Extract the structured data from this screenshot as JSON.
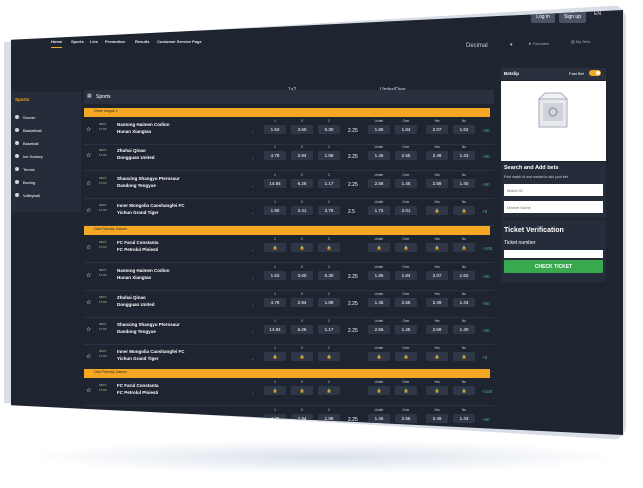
{
  "header": {
    "login_label": "Log in",
    "signup_label": "Sign up",
    "language": "EN"
  },
  "nav": {
    "items": [
      "Home",
      "Sports",
      "Live",
      "Promotion",
      "Results",
      "Customer Service Page"
    ],
    "odds_format": "Decimal",
    "favorites_label": "Favorites",
    "mybets_label": "My Bets"
  },
  "sidebar": {
    "title": "Sports",
    "items": [
      "Soccer",
      "Basketball",
      "Baseball",
      "Ice Hockey",
      "Tennis",
      "Boxing",
      "Volleyball"
    ]
  },
  "main": {
    "header_label": "Sports",
    "col_1x2": "1x2",
    "col_underover": "Under/Over",
    "leagues": [
      "Chine league 1",
      "Club Friendly Games",
      "Club Friendly Games"
    ],
    "labels_1x2": [
      "1",
      "X",
      "2"
    ],
    "labels_uo": [
      "Under",
      "Over"
    ],
    "labels_yn": [
      "Yes",
      "No"
    ],
    "matches": [
      {
        "date": "06/07",
        "time": "17:00",
        "t1": "Nantong Haimen Codion",
        "t2": "Hunan Xiangtao",
        "o1": "1.63",
        "ox": "3.60",
        "o2": "5.30",
        "hcp": "2.25",
        "un": "1.86",
        "ov": "1.84",
        "yes": "2.07",
        "no": "1.62",
        "more": "+50"
      },
      {
        "date": "06/07",
        "time": "17:00",
        "t1": "Zhuhai Qinao",
        "t2": "Dongguan United",
        "o1": "4.78",
        "ox": "2.94",
        "o2": "1.88",
        "hcp": "2.25",
        "un": "1.45",
        "ov": "2.55",
        "yes": "2.49",
        "no": "1.43",
        "more": "+50"
      },
      {
        "date": "06/07",
        "time": "17:00",
        "t1": "Shaoxing Shangyu Pterosaur",
        "t2": "Dandong Tengyue",
        "o1": "14.84",
        "ox": "6.26",
        "o2": "1.17",
        "hcp": "2.25",
        "un": "2.56",
        "ov": "1.45",
        "yes": "2.59",
        "no": "1.40",
        "more": "+50"
      },
      {
        "date": "06/07",
        "time": "17:00",
        "t1": "Inner Mongolia Caoshangfei FC",
        "t2": "Yichun Grand Tiger",
        "o1": "1.90",
        "ox": "3.41",
        "o2": "3.75",
        "hcp": "2.5",
        "un": "1.72",
        "ov": "2.01",
        "yes": "",
        "no": "",
        "more": "+5"
      },
      {
        "date": "06/07",
        "time": "17:00",
        "t1": "FC Farul Constanta",
        "t2": "FC Petrolul Ploiesti",
        "o1": "",
        "ox": "",
        "o2": "",
        "hcp": "",
        "un": "",
        "ov": "",
        "yes": "",
        "no": "",
        "more": "+100"
      },
      {
        "date": "06/07",
        "time": "17:00",
        "t1": "Nantong Haimen Codion",
        "t2": "Hunan Xiangtao",
        "o1": "1.63",
        "ox": "3.60",
        "o2": "5.30",
        "hcp": "2.25",
        "un": "1.86",
        "ov": "1.84",
        "yes": "2.07",
        "no": "1.62",
        "more": "+50"
      },
      {
        "date": "06/07",
        "time": "17:00",
        "t1": "Zhuhai Qinao",
        "t2": "Dongguan United",
        "o1": "4.78",
        "ox": "2.94",
        "o2": "1.88",
        "hcp": "2.25",
        "un": "1.45",
        "ov": "2.55",
        "yes": "2.49",
        "no": "1.43",
        "more": "+50"
      },
      {
        "date": "06/07",
        "time": "17:00",
        "t1": "Shaoxing Shangyu Pterosaur",
        "t2": "Dandong Tengyue",
        "o1": "14.84",
        "ox": "6.26",
        "o2": "1.17",
        "hcp": "2.25",
        "un": "2.56",
        "ov": "1.45",
        "yes": "2.59",
        "no": "1.40",
        "more": "+50"
      },
      {
        "date": "06/07",
        "time": "17:00",
        "t1": "Inner Mongolia Caoshangfei FC",
        "t2": "Yichun Grand Tiger",
        "o1": "",
        "ox": "",
        "o2": "",
        "hcp": "",
        "un": "",
        "ov": "",
        "yes": "",
        "no": "",
        "more": "+5"
      },
      {
        "date": "06/07",
        "time": "17:00",
        "t1": "FC Farul Constanta",
        "t2": "FC Petrolul Ploiesti",
        "o1": "",
        "ox": "",
        "o2": "",
        "hcp": "",
        "un": "",
        "ov": "",
        "yes": "",
        "no": "",
        "more": "+100"
      },
      {
        "date": "06/07",
        "time": "17:00",
        "t1": "Zhuhai Qinao",
        "t2": "Dongguan United",
        "o1": "4.78",
        "ox": "2.94",
        "o2": "1.88",
        "hcp": "2.25",
        "un": "1.45",
        "ov": "2.55",
        "yes": "2.49",
        "no": "1.43",
        "more": "+50"
      }
    ]
  },
  "betslip": {
    "title": "Betslip",
    "fastbet_label": "Fast Bet",
    "search_title": "Search and Add bets",
    "search_desc": "Find match id and market to add your bet",
    "match_id_placeholder": "Match ID",
    "market_placeholder": "Market Name",
    "ticket_title": "Ticket Verification",
    "ticket_label": "Ticket number",
    "check_label": "CHECK TICKET"
  },
  "colors": {
    "accent": "#f5a623",
    "background": "#1e2430",
    "positive": "#38c172",
    "button_green": "#38a94f"
  }
}
